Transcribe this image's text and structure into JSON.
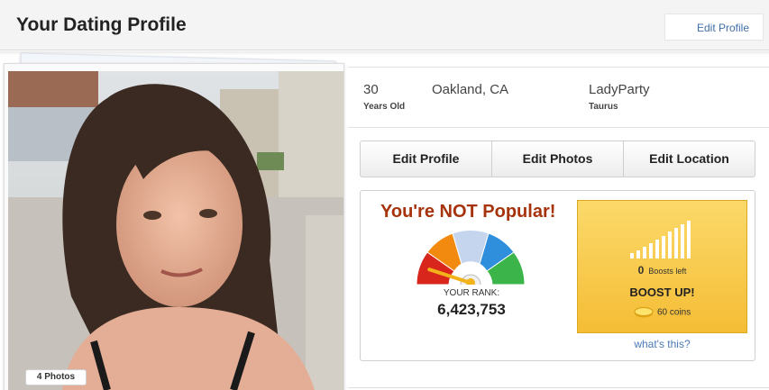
{
  "header": {
    "title": "Your Dating Profile",
    "edit_link": "Edit Profile"
  },
  "photo": {
    "count_label": "4 Photos"
  },
  "profile": {
    "age": "30",
    "age_label": "Years Old",
    "location": "Oakland, CA",
    "username": "LadyParty",
    "sign": "Taurus"
  },
  "actions": {
    "edit_profile": "Edit Profile",
    "edit_photos": "Edit Photos",
    "edit_location": "Edit Location"
  },
  "popularity": {
    "title": "You're NOT Popular!",
    "rank_label": "YOUR RANK:",
    "rank_value": "6,423,753",
    "gauge_level": 0.1
  },
  "boost": {
    "boosts_count": "0",
    "boosts_label": "Boosts left",
    "cta": "BOOST UP!",
    "coins": "60 coins",
    "help_link": "what's this?",
    "signal_icon": "signal-bars-icon",
    "coin_icon": "coin-icon"
  },
  "colors": {
    "title_red": "#a6330c",
    "link_blue": "#3f6fa8",
    "boost_yellow": "#f8c94a",
    "gauge_red": "#d9261c",
    "gauge_orange": "#f28a10",
    "gauge_lightblue": "#c5d5ee",
    "gauge_blue": "#2f8fdd",
    "gauge_green": "#3bb44a"
  }
}
